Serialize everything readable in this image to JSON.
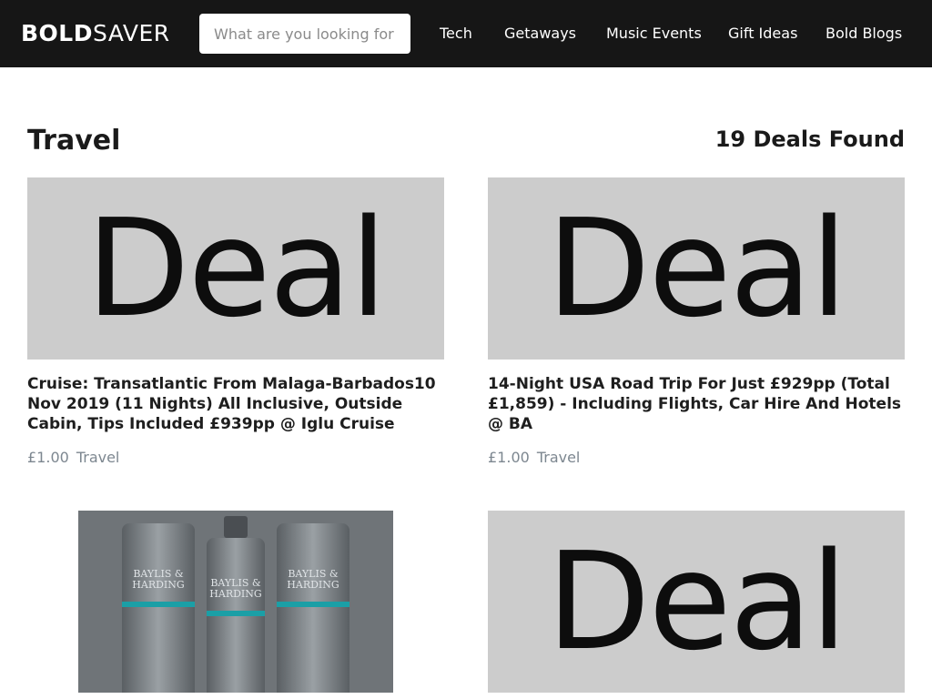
{
  "header": {
    "logo_bold": "BOLD",
    "logo_light": "SAVER",
    "search_placeholder": "What are you looking for",
    "nav": [
      "Tech",
      "Getaways",
      "Music Events",
      "Gift Ideas",
      "Bold Blogs"
    ]
  },
  "page": {
    "title": "Travel",
    "deals_found": "19 Deals Found"
  },
  "deals": [
    {
      "image_text": "Deal",
      "title": "Cruise: Transatlantic From Malaga-Barbados10 Nov 2019 (11 Nights) All Inclusive, Outside Cabin, Tips Included £939pp @ Iglu Cruise",
      "price": "£1.00",
      "category": "Travel"
    },
    {
      "image_text": "Deal",
      "title": "14-Night USA Road Trip For Just £929pp (Total £1,859) - Including Flights, Car Hire And Hotels @ BA",
      "price": "£1.00",
      "category": "Travel"
    },
    {
      "image_brand": "BAYLIS & HARDING"
    },
    {
      "image_text": "Deal"
    }
  ],
  "colors": {
    "header_bg": "#161616",
    "placeholder_bg": "#cccccc",
    "meta_text": "#7d8790",
    "accent_teal": "#1b9fa6"
  }
}
